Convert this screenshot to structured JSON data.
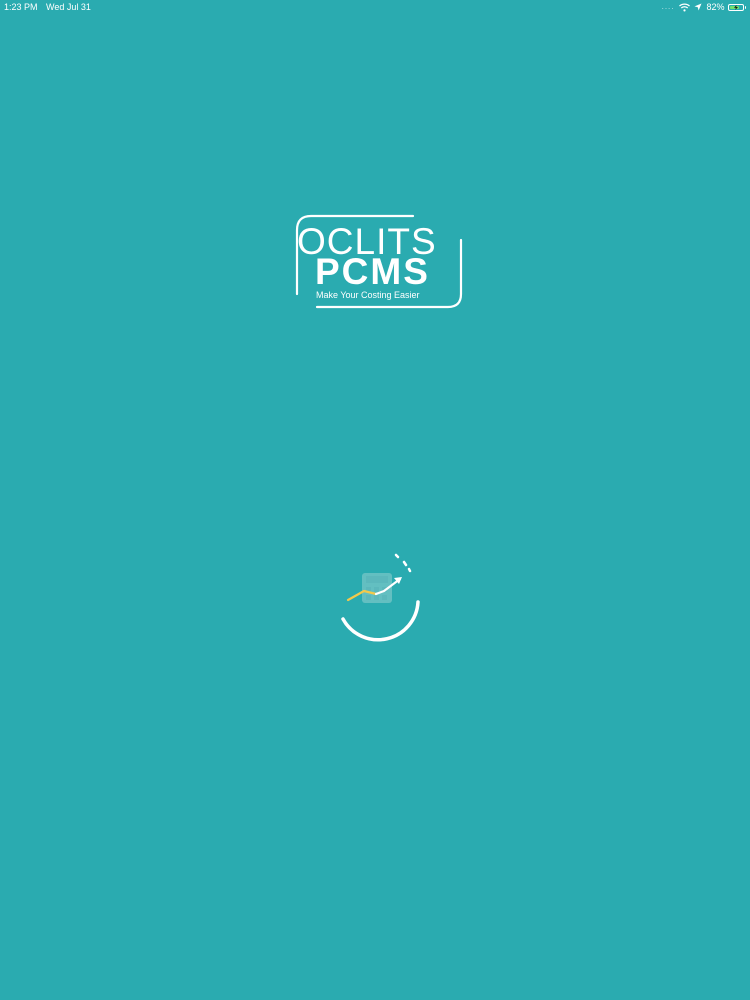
{
  "status_bar": {
    "time": "1:23 PM",
    "date": "Wed Jul 31",
    "signal": "....",
    "battery_percent": "82%",
    "battery_level": 0.82,
    "icons": [
      "wifi-icon",
      "location-arrow-icon",
      "battery-charging-icon"
    ]
  },
  "logo": {
    "brand_word1": "OCLITS",
    "brand_word2": "PCMS",
    "tagline": "Make Your Costing Easier"
  },
  "loader": {
    "icons": [
      "chart-trend-arrow-icon",
      "calculator-icon"
    ],
    "colors": {
      "accent": "#f2c94c",
      "stroke": "#ffffff"
    }
  },
  "theme": {
    "background": "#2aabb0",
    "foreground": "#ffffff"
  }
}
